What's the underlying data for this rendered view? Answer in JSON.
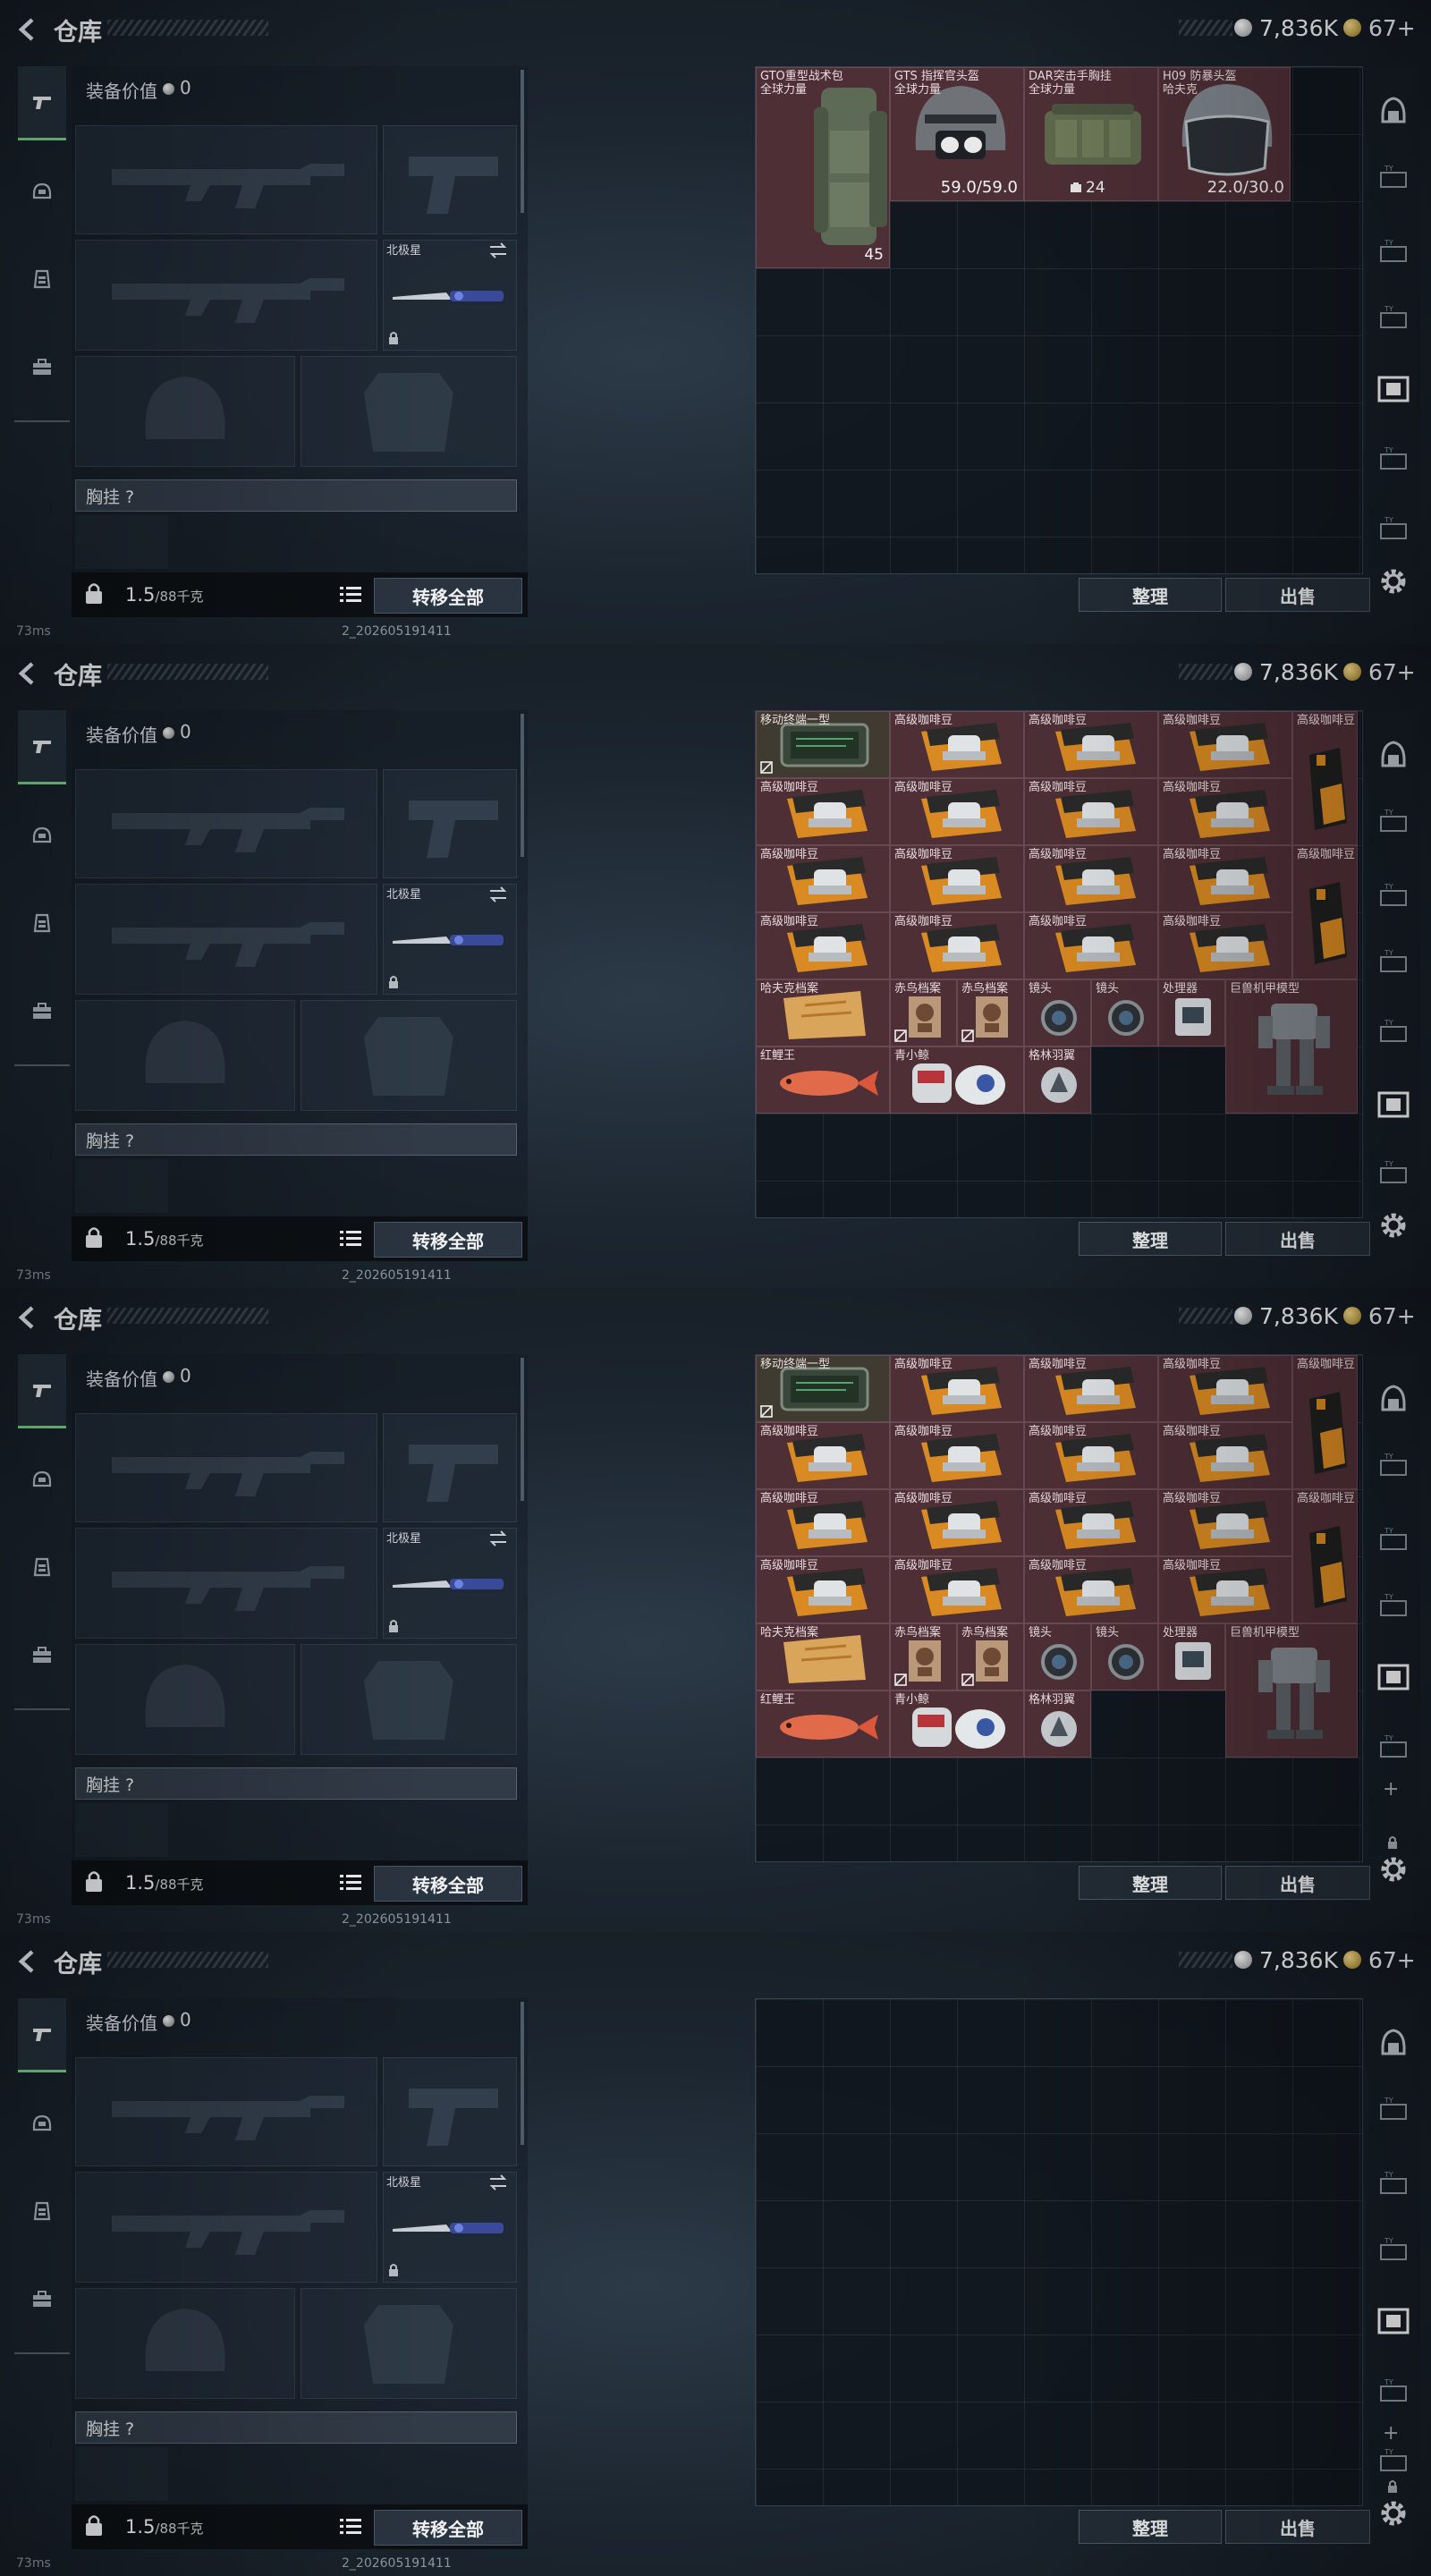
{
  "header": {
    "title": "仓库",
    "silver": "7,836K",
    "gold": "67+"
  },
  "loadout": {
    "equip_value_label": "装备价值",
    "equip_value": "0",
    "knife_name": "北极星",
    "rig_label": "胸挂 ?",
    "weight": "1.5",
    "weight_unit": "/88千克",
    "transfer_all": "转移全部"
  },
  "storage": {
    "sort": "整理",
    "sell": "出售"
  },
  "footer": {
    "ping": "73ms",
    "build": "2_202605191411"
  },
  "frame1_items": {
    "backpack": {
      "name": "GTO重型战术包",
      "sub": "全球力量",
      "qty": "45"
    },
    "helmet_gts": {
      "name": "GTS 指挥官头盔",
      "sub": "全球力量",
      "qty": "59.0/59.0"
    },
    "rig_dar": {
      "name": "DAR突击手胸挂",
      "sub": "全球力量",
      "qty": "24"
    },
    "helmet_h09": {
      "name": "H09 防暴头盔",
      "sub": "哈夫克",
      "qty": "22.0/30.0"
    }
  },
  "frame2_items": {
    "mobile_terminal": "移动终端一型",
    "coffee": "高级咖啡豆",
    "havoc_file": "哈夫克档案",
    "falcon_file": "赤鸟档案",
    "lens": "镜头",
    "processor": "处理器",
    "mech_model": "巨兽机甲模型",
    "koi": "红鲤王",
    "little_whale": "青小鲸",
    "wing": "格林羽翼"
  },
  "icons": {
    "back": "back-chevron-icon",
    "silver_coin": "silver-coin-icon",
    "gold_coin": "gold-coin-icon",
    "lock": "lock-icon",
    "list": "list-icon",
    "gear": "gear-icon",
    "swap": "swap-icon"
  },
  "colors": {
    "item_bg": "#4e2f36",
    "accent_green": "#7ad48c",
    "grid_bg": "#10161c"
  }
}
